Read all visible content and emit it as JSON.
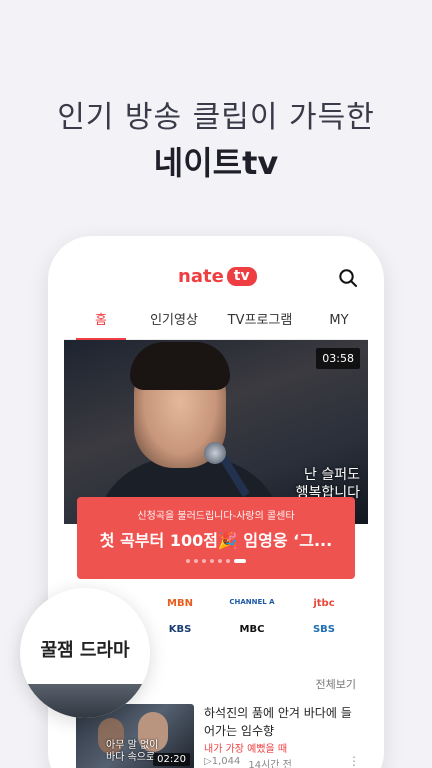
{
  "promo": {
    "line1": "인기 방송 클립이 가득한",
    "line2": "네이트tv"
  },
  "app": {
    "logo_text": "nate",
    "logo_badge": "tv",
    "search_icon": "search-icon",
    "brand_color": "#ef3e42"
  },
  "tabs": [
    {
      "label": "홈",
      "active": true
    },
    {
      "label": "인기영상",
      "active": false
    },
    {
      "label": "TV프로그램",
      "active": false
    },
    {
      "label": "MY",
      "active": false
    }
  ],
  "hero": {
    "duration": "03:58",
    "subtitle_line1": "난 슬퍼도",
    "subtitle_line2": "행복합니다"
  },
  "featured_card": {
    "subtitle": "신청곡을 불러드립니다-사랑의 콜센타",
    "title": "첫 곡부터 100점🎉 임영웅 ‘그...",
    "dots_total": 7,
    "dots_active_index": 6,
    "color": "#ef5350"
  },
  "broadcasters": [
    {
      "name": "MBN",
      "color": "#e85c1e"
    },
    {
      "name": "CHANNEL A",
      "color": "#1e5aa8"
    },
    {
      "name": "jtbc",
      "color": "#e8483b"
    },
    {
      "name": "KBS",
      "color": "#1b3c73"
    },
    {
      "name": "MBC",
      "color": "#111111"
    },
    {
      "name": "SBS",
      "color": "#1f6fb4"
    }
  ],
  "section": {
    "label": "꿀잼 드라마",
    "more_label": "전체보기"
  },
  "clip": {
    "title": "하석진의 품에 안겨 바다에 들어가는 임수향",
    "subtitle": "내가 가장 예뻤을 때",
    "views": "1,044",
    "time_ago": "14시간 전",
    "duration": "02:20",
    "caption_line1": "아무 말 없이",
    "caption_line2": "바다 속으로"
  }
}
